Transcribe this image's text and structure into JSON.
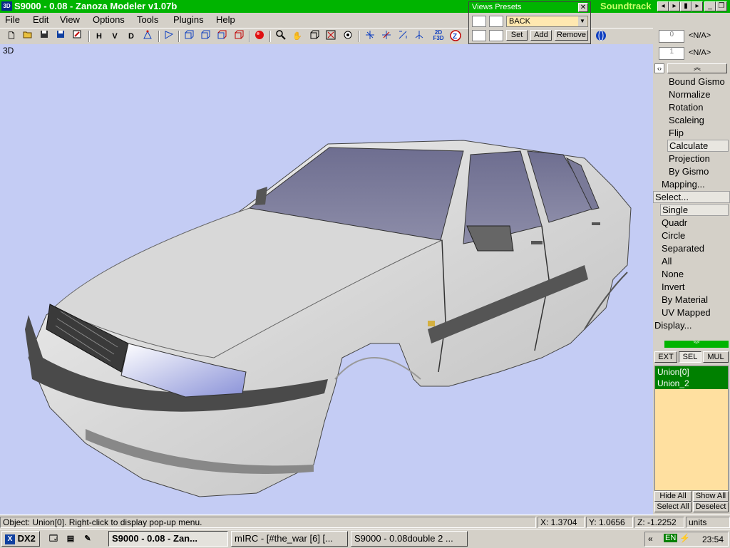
{
  "window": {
    "title": "S9000 - 0.08 - Zanoza Modeler v1.07b",
    "app_icon": "3D",
    "background_title": "Soundtrack",
    "controls": [
      "minimize-icon",
      "maximize-icon",
      "close-icon"
    ]
  },
  "menu": [
    "File",
    "Edit",
    "View",
    "Options",
    "Tools",
    "Plugins",
    "Help"
  ],
  "toolbar": {
    "letters": {
      "h": "H",
      "v": "V",
      "d": "D"
    },
    "icons": [
      "new-icon",
      "open-icon",
      "save-icon",
      "save-as-icon",
      "export-icon",
      "select-icon",
      "vertex-icon",
      "box-front-icon",
      "box-side-icon",
      "box-top-icon",
      "box-persp-icon",
      "render-ball-icon",
      "zoom-icon",
      "pan-icon",
      "rotate-view-icon",
      "zoom-extents-icon",
      "zoom-region-icon",
      "move-icon",
      "scale-icon",
      "rotate-icon",
      "mirror-icon",
      "unwrap-icon",
      "z-icon"
    ],
    "mode_label": "2D\nF3D"
  },
  "presets": {
    "title": "Views Presets",
    "current": "BACK",
    "set": "Set",
    "add": "Add",
    "remove": "Remove"
  },
  "viewport": {
    "label": "3D",
    "object": "car-body-model",
    "background": "#c4ccf4"
  },
  "right_panel": {
    "spin1": "0",
    "spin1_label": "<N/A>",
    "spin2": "1",
    "spin2_label": "<N/A>",
    "uv_items": [
      "Bound Gismo",
      "Normalize",
      "Rotation",
      "Scaleing",
      "Flip",
      "Calculate",
      "Projection",
      "By Gismo"
    ],
    "mapping": "Mapping...",
    "select": "Select...",
    "select_items": [
      "Single",
      "Quadr",
      "Circle",
      "Separated",
      "All",
      "None",
      "Invert",
      "By Material",
      "UV Mapped"
    ],
    "display": "Display...",
    "tabs": [
      "EXT",
      "SEL",
      "MUL"
    ],
    "objects": [
      "Union[0]",
      "Union_2"
    ],
    "hide_all": "Hide All",
    "show_all": "Show All",
    "select_all": "Select All",
    "deselect": "Deselect"
  },
  "status": {
    "message": "Object: Union[0]. Right-click to display pop-up menu.",
    "x": "X: 1.3704",
    "y": "Y: 1.0656",
    "z": "Z: -1.2252",
    "units": "units"
  },
  "taskbar": {
    "start": "DX2",
    "tasks": [
      "S9000 - 0.08 - Zan...",
      "mIRC - [#the_war [6] [...",
      "S9000 - 0.08double 2 ..."
    ],
    "lang": "EN",
    "clock": "23:54"
  }
}
